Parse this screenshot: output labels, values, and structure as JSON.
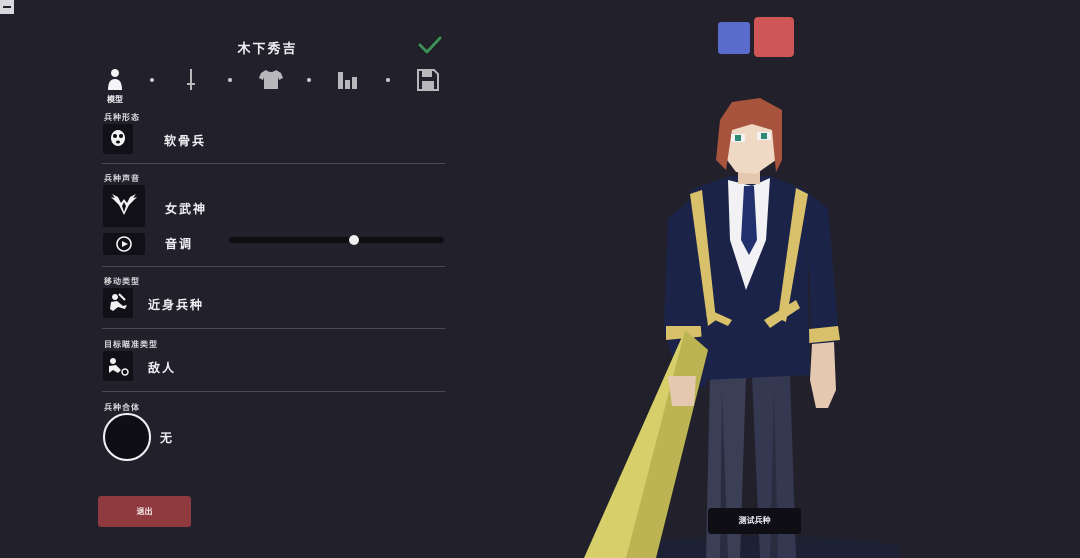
{
  "unit": {
    "name": "木下秀吉"
  },
  "tabs": [
    {
      "icon": "figure-icon",
      "label": "模型"
    },
    {
      "icon": "sword-icon",
      "label": ""
    },
    {
      "icon": "shirt-icon",
      "label": ""
    },
    {
      "icon": "stats-icon",
      "label": ""
    },
    {
      "icon": "save-icon",
      "label": ""
    }
  ],
  "sections": {
    "form": {
      "label": "兵种形态",
      "value": "软骨兵",
      "icon": "skull-face-icon"
    },
    "voice": {
      "label": "兵种声音",
      "value": "女武神",
      "icon": "valkyrie-wings-icon",
      "pitch_label": "音调",
      "pitch_value": 0.58
    },
    "movement": {
      "label": "移动类型",
      "value": "近身兵种",
      "icon": "melee-unit-icon"
    },
    "targeting": {
      "label": "目标瞄准类型",
      "value": "敌人",
      "icon": "target-enemy-icon"
    },
    "combine": {
      "label": "兵种合体",
      "value": "无"
    }
  },
  "buttons": {
    "exit": "退出",
    "test": "测试兵种"
  },
  "team_colors": {
    "blue": "#5a6ccb",
    "red": "#cf5656"
  }
}
